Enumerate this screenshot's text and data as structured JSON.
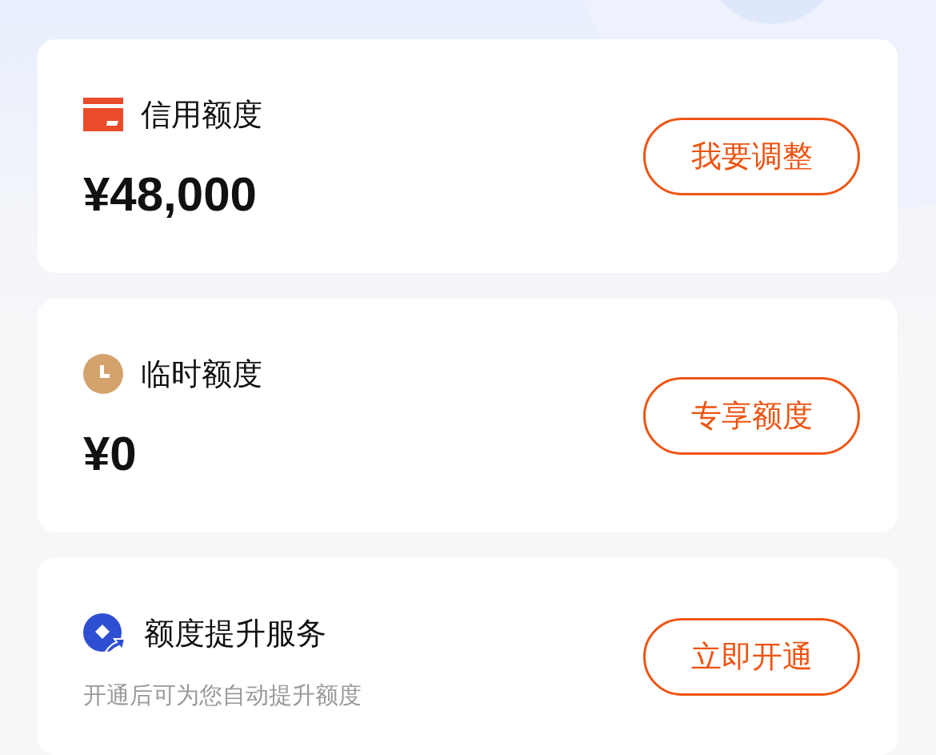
{
  "cards": [
    {
      "kind": "amount",
      "title": "信用额度",
      "amount": "¥48,000",
      "button": "我要调整"
    },
    {
      "kind": "amount",
      "title": "临时额度",
      "amount": "¥0",
      "button": "专享额度"
    },
    {
      "kind": "subtitle",
      "title": "额度提升服务",
      "subtitle": "开通后可为您自动提升额度",
      "button": "立即开通"
    }
  ]
}
